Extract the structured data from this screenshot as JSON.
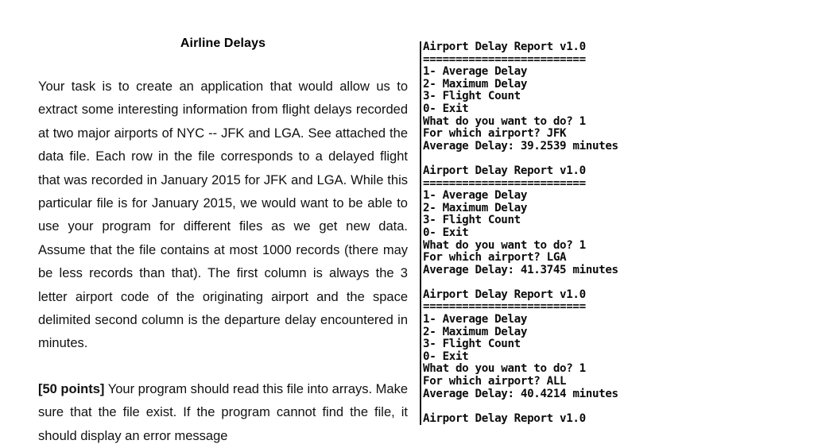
{
  "document": {
    "title": "Airline Delays",
    "paragraphs": [
      {
        "id": "para-1",
        "bold_lead": "",
        "text": "Your task is to create an application that would allow us to extract some interesting information from flight delays recorded at two major airports of NYC -- JFK and LGA. See attached the data file. Each row in the file corresponds to a delayed flight that was recorded in January 2015 for JFK and LGA. While this particular file is for January 2015, we would want to be able to use your program for different files as we get new data. Assume that the file contains at most 1000 records (there may be less records than that). The first column is always the 3 letter airport code of the originating airport and the space delimited second column is the departure delay encountered in minutes."
      },
      {
        "id": "para-2",
        "bold_lead": "[50 points]",
        "text": " Your program should read this file into arrays. Make sure that the file exist. If the program cannot find the file, it should display an error message"
      }
    ]
  },
  "console": {
    "program_title": "Airport Delay Report v1.0",
    "separator": "=========================",
    "menu": [
      "1- Average Delay",
      "2- Maximum Delay",
      "3- Flight Count",
      "0- Exit"
    ],
    "prompt_action": "What do you want to do? ",
    "prompt_airport": "For which airport? ",
    "result_label": "Average Delay: ",
    "result_suffix": " minutes",
    "sessions": [
      {
        "action_choice": "1",
        "airport": "JFK",
        "result_value": "39.2539"
      },
      {
        "action_choice": "1",
        "airport": "LGA",
        "result_value": "41.3745"
      },
      {
        "action_choice": "1",
        "airport": "ALL",
        "result_value": "40.4214"
      }
    ],
    "trailing_partial_title": "Airport Delay Report v1.0"
  },
  "colors": {
    "page_background": "#ffffff",
    "text": "#000000",
    "divider": "#1a1a1a",
    "console_text": "#0b0b0b"
  }
}
